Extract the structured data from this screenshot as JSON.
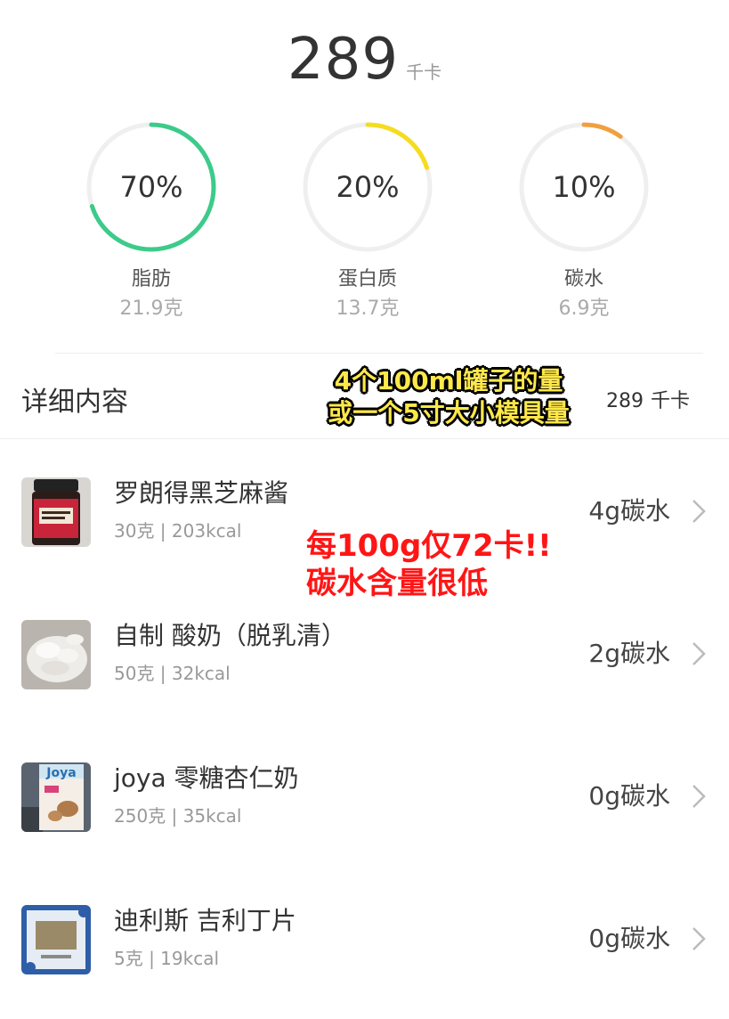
{
  "summary": {
    "calories": "289",
    "unit": "千卡"
  },
  "macros": [
    {
      "percent": "70%",
      "fraction": 0.7,
      "label": "脂肪",
      "grams": "21.9克",
      "color": "#3ccb8a"
    },
    {
      "percent": "20%",
      "fraction": 0.2,
      "label": "蛋白质",
      "grams": "13.7克",
      "color": "#f5dc1e"
    },
    {
      "percent": "10%",
      "fraction": 0.1,
      "label": "碳水",
      "grams": "6.9克",
      "color": "#f0a040"
    }
  ],
  "details": {
    "title": "详细内容",
    "total": "289",
    "unit": "千卡"
  },
  "overlays": {
    "top_line1": "4个100ml罐子的量",
    "top_line2": "或一个5寸大小模具量",
    "red_line1": "每100g仅72卡!!",
    "red_line2": "碳水含量很低"
  },
  "items": [
    {
      "name": "罗朗得黑芝麻酱",
      "sub": "30克 | 203kcal",
      "carb": "4g碳水",
      "thumb_icon": "tahini-jar-icon"
    },
    {
      "name": "自制 酸奶（脱乳清）",
      "sub": "50克 | 32kcal",
      "carb": "2g碳水",
      "thumb_icon": "yogurt-icon"
    },
    {
      "name": "joya 零糖杏仁奶",
      "sub": "250克 | 35kcal",
      "carb": "0g碳水",
      "thumb_icon": "almond-milk-carton-icon",
      "thumb_text": "Joya"
    },
    {
      "name": "迪利斯 吉利丁片",
      "sub": "5克 | 19kcal",
      "carb": "0g碳水",
      "thumb_icon": "gelatin-pack-icon"
    }
  ],
  "colors": {
    "ring_track": "#efefef",
    "overlay_red": "#ff1515",
    "overlay_yellow": "#ffe84a"
  }
}
